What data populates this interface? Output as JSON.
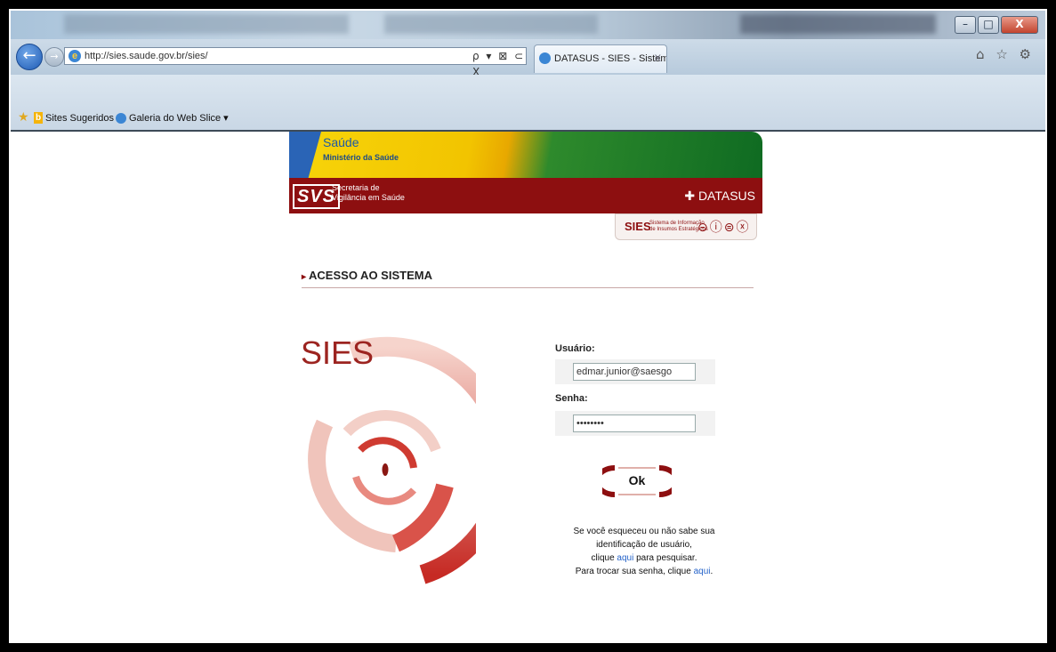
{
  "browser": {
    "url": "http://sies.saude.gov.br/sies/",
    "tab_title": "DATASUS - SIES - Sistema d...",
    "tab_close": "X",
    "search_tools": "ρ ▾ ⊠ ⊂ X",
    "right_buttons": "⌂ ☆ ⚙",
    "window_controls": {
      "minimize": "–",
      "maximize": "□",
      "close": "X"
    },
    "favorites": [
      {
        "label": "Sites Sugeridos ▾",
        "icon": "bing-icon"
      },
      {
        "label": "Galeria do Web Slice ▾",
        "icon": "ie-icon"
      }
    ]
  },
  "banner": {
    "saude": "Saúde",
    "ministerio": "Ministério da Saúde",
    "svs_logo": "SVS",
    "secretaria_line1": "Secretaria de",
    "secretaria_line2": "Vigilância em Saúde",
    "datasus": "✚ DATASUS",
    "sies_mark": "SIES",
    "sies_desc_line1": "Sistema de Informação",
    "sies_desc_line2": "de Insumos Estratégicos",
    "sies_icons": "⊝ⓘ⊜ⓧ"
  },
  "page": {
    "section_title": "ACESSO AO SISTEMA",
    "logo_text": "SIES"
  },
  "form": {
    "user_label": "Usuário:",
    "user_value": "edmar.junior@saesgo",
    "password_label": "Senha:",
    "password_value": "••••••••",
    "ok_label": "Ok"
  },
  "help": {
    "line1": "Se você esqueceu ou não sabe sua",
    "line2": "identificação de usuário,",
    "line3_pre": "clique ",
    "line3_link": "aqui",
    "line3_post": " para pesquisar.",
    "line4_pre": "Para trocar sua senha, clique ",
    "line4_link": "aqui",
    "line4_post": "."
  }
}
